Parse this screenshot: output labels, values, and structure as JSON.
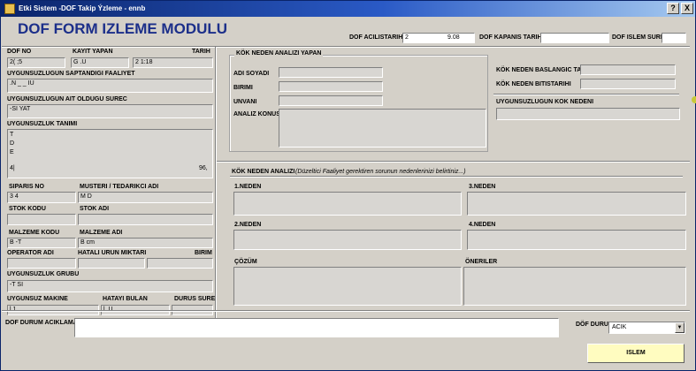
{
  "window": {
    "title": "Etki Sistem -DOF Takip Ýzleme  - ennb",
    "help_label": "?",
    "close_label": "X"
  },
  "form_title": "DOF FORM IZLEME MODULU",
  "top_fields": {
    "acilis_label": "DOF ACILISTARIHI :",
    "acilis_value_a": "2",
    "acilis_value_b": "9.08",
    "kapanis_label": "DOF KAPANIS TARIHI :",
    "islem_sure_label": "DOF ISLEM SURE :"
  },
  "left": {
    "dof_no_label": "DOF NO",
    "dof_no_value": "2(      ;5",
    "kayit_yapan_label": "KAYIT YAPAN",
    "kayit_yapan_value": "G           .U",
    "tarih_label": "TARIH",
    "tarih_value": "2            1:18",
    "faaliyet_label": "UYGUNSUZLUGUN SAPTANDIGI FAALIYET",
    "faaliyet_value": ".N         _    _         IU",
    "surec_label": "UYGUNSUZLUGUN AIT OLDUGU SUREC",
    "surec_value": "-SI          YAT",
    "tanim_label": "UYGUNSUZLUK TANIMI",
    "tanim_lines": [
      "T",
      "D",
      "E",
      "4|"
    ],
    "tanim_right": "96,",
    "siparis_label": "SIPARIS NO",
    "siparis_value": "3        4",
    "musteri_label": "MUSTERI / TEDARIKCI ADI",
    "musteri_value": "M              D",
    "stok_kodu_label": "STOK KODU",
    "stok_adi_label": "STOK ADI",
    "malzeme_kodu_label": "MALZEME KODU",
    "malzeme_kodu_value": "B           -T",
    "malzeme_adi_label": "MALZEME ADI",
    "malzeme_adi_value": "B                                  cm",
    "operator_label": "OPERATOR ADI",
    "hatali_label": "HATALI URUN MIKTARI",
    "birim_label": "BIRIM",
    "grubu_label": "UYGUNSUZLUK GRUBU",
    "grubu_value": "-T                        SI",
    "makine_label": "UYGUNSUZ MAKINE",
    "makine_value": "l          1",
    "hatayi_label": "HATAYI BULAN",
    "hatayi_value": "l                      .U",
    "durus_label": "DURUS SURE"
  },
  "kok_neden_yapan": {
    "group_title": "KÖK NEDEN ANALIZI YAPAN",
    "adi_soyadi_label": "ADI SOYADI",
    "birimi_label": "BIRIMI",
    "unvani_label": "UNVANI",
    "analiz_konusu_label": "ANALIZ KONUSU",
    "baslangic_label": "KÖK NEDEN BASLANGIC TARIHI",
    "bitis_label": "KÖK NEDEN BITISTARIHI",
    "kok_nedeni_label": "UYGUNSUZLUGUN KOK NEDENI"
  },
  "kok_neden_analizi": {
    "title": "KÖK NEDEN ANALIZI",
    "hint": "(Düzeltici Faaliyet gerektiren sorunun nedenlerinizi belirtiniz...)",
    "neden1": "1.NEDEN",
    "neden2": "2.NEDEN",
    "neden3": "3.NEDEN",
    "neden4": "4.NEDEN",
    "cozum": "ÇÖZÜM",
    "oneriler": "ÖNERILER"
  },
  "bottom": {
    "aciklama_label": "DOF DURUM ACIKLAMA :",
    "durum_label": "DÖF DURUM",
    "durum_value": "ACIK",
    "islem_button": "ISLEM"
  }
}
